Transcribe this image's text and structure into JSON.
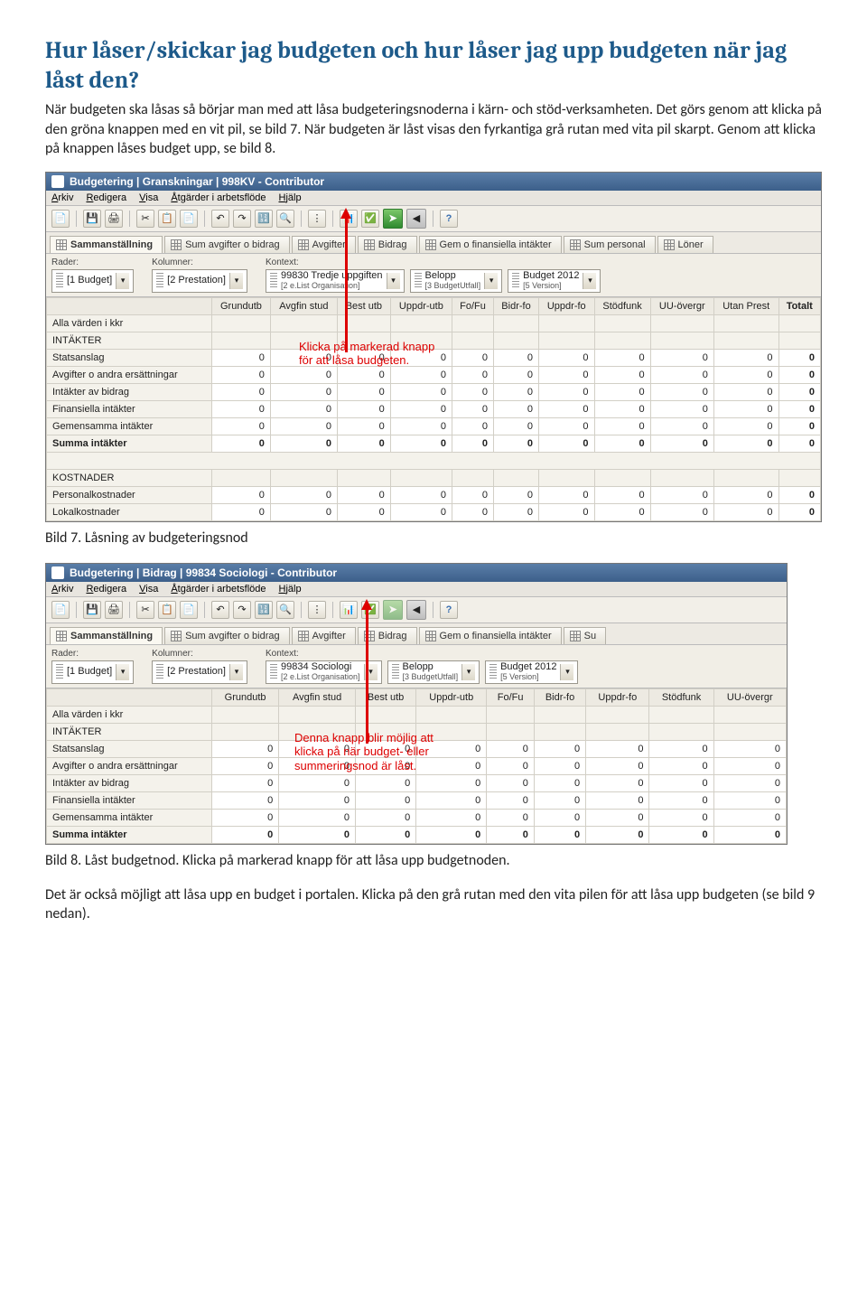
{
  "heading": "Hur låser/skickar jag budgeten och hur låser jag upp budgeten när jag låst den?",
  "intro": "När budgeten ska låsas så börjar man med att låsa budgeteringsnoderna i kärn- och stöd-verksamheten. Det görs genom att klicka på den gröna knappen med en vit pil, se bild 7. När budgeten är låst visas den fyrkantiga grå rutan med vita pil skarpt. Genom att klicka på knappen låses budget upp, se bild 8.",
  "caption7": "Bild 7. Låsning av budgeteringsnod",
  "caption8": "Bild 8. Låst budgetnod. Klicka på markerad knapp för att låsa upp budgetnoden.",
  "outro": "Det är också möjligt att låsa upp en budget i portalen. Klicka på den grå rutan med den vita pilen för att låsa upp budgeten (se bild 9 nedan).",
  "shot1": {
    "title": "Budgetering | Granskningar | 998KV - Contributor",
    "menus": [
      "Arkiv",
      "Redigera",
      "Visa",
      "Åtgärder i arbetsflöde",
      "Hjälp"
    ],
    "tabs": [
      "Sammanställning",
      "Sum avgifter o bidrag",
      "Avgifter",
      "Bidrag",
      "Gem o finansiella intäkter",
      "Sum personal",
      "Löner"
    ],
    "selectors": {
      "rader_lbl": "Rader:",
      "rader": "[1 Budget]",
      "kolumner_lbl": "Kolumner:",
      "kolumner": "[2 Prestation]",
      "kontext_lbl": "Kontext:",
      "kontext": "99830 Tredje uppgiften",
      "kontext_sub": "[2 e.List Organisation]",
      "belopp": "Belopp",
      "belopp_sub": "[3 BudgetUtfall]",
      "version": "Budget 2012",
      "version_sub": "[5 Version]"
    },
    "cols": [
      "Grundutb",
      "Avgfin stud",
      "Best utb",
      "Uppdr-utb",
      "Fo/Fu",
      "Bidr-fo",
      "Uppdr-fo",
      "Stödfunk",
      "UU-övergr",
      "Utan Prest",
      "Totalt"
    ],
    "rows": [
      {
        "label": "Alla värden i kkr",
        "type": "section"
      },
      {
        "label": "INTÄKTER",
        "type": "section"
      },
      {
        "label": "Statsanslag",
        "vals": [
          0,
          0,
          0,
          0,
          0,
          0,
          0,
          0,
          0,
          0,
          0
        ]
      },
      {
        "label": "Avgifter o andra ersättningar",
        "vals": [
          0,
          0,
          0,
          0,
          0,
          0,
          0,
          0,
          0,
          0,
          0
        ]
      },
      {
        "label": "Intäkter av bidrag",
        "vals": [
          0,
          0,
          0,
          0,
          0,
          0,
          0,
          0,
          0,
          0,
          0
        ]
      },
      {
        "label": "Finansiella intäkter",
        "vals": [
          0,
          0,
          0,
          0,
          0,
          0,
          0,
          0,
          0,
          0,
          0
        ]
      },
      {
        "label": "Gemensamma intäkter",
        "vals": [
          0,
          0,
          0,
          0,
          0,
          0,
          0,
          0,
          0,
          0,
          0
        ]
      },
      {
        "label": "Summa intäkter",
        "vals": [
          0,
          0,
          0,
          0,
          0,
          0,
          0,
          0,
          0,
          0,
          0
        ],
        "bold": true
      },
      {
        "label": "",
        "type": "spacer"
      },
      {
        "label": "KOSTNADER",
        "type": "section"
      },
      {
        "label": "Personalkostnader",
        "vals": [
          0,
          0,
          0,
          0,
          0,
          0,
          0,
          0,
          0,
          0,
          0
        ]
      },
      {
        "label": "Lokalkostnader",
        "vals": [
          0,
          0,
          0,
          0,
          0,
          0,
          0,
          0,
          0,
          0,
          0
        ]
      }
    ],
    "annotation": "Klicka på markerad knapp\nför att låsa budgeten."
  },
  "shot2": {
    "title": "Budgetering | Bidrag | 99834 Sociologi - Contributor",
    "menus": [
      "Arkiv",
      "Redigera",
      "Visa",
      "Åtgärder i arbetsflöde",
      "Hjälp"
    ],
    "tabs": [
      "Sammanställning",
      "Sum avgifter o bidrag",
      "Avgifter",
      "Bidrag",
      "Gem o finansiella intäkter",
      "Su"
    ],
    "selectors": {
      "rader_lbl": "Rader:",
      "rader": "[1 Budget]",
      "kolumner_lbl": "Kolumner:",
      "kolumner": "[2 Prestation]",
      "kontext_lbl": "Kontext:",
      "kontext": "99834 Sociologi",
      "kontext_sub": "[2 e.List Organisation]",
      "belopp": "Belopp",
      "belopp_sub": "[3 BudgetUtfall]",
      "version": "Budget 2012",
      "version_sub": "[5 Version]"
    },
    "cols": [
      "Grundutb",
      "Avgfin stud",
      "Best utb",
      "Uppdr-utb",
      "Fo/Fu",
      "Bidr-fo",
      "Uppdr-fo",
      "Stödfunk",
      "UU-övergr"
    ],
    "rows": [
      {
        "label": "Alla värden i kkr",
        "type": "section"
      },
      {
        "label": "INTÄKTER",
        "type": "section"
      },
      {
        "label": "Statsanslag",
        "vals": [
          0,
          0,
          0,
          0,
          0,
          0,
          0,
          0,
          0
        ]
      },
      {
        "label": "Avgifter o andra ersättningar",
        "vals": [
          0,
          0,
          0,
          0,
          0,
          0,
          0,
          0,
          0
        ]
      },
      {
        "label": "Intäkter av bidrag",
        "vals": [
          0,
          0,
          0,
          0,
          0,
          0,
          0,
          0,
          0
        ]
      },
      {
        "label": "Finansiella intäkter",
        "vals": [
          0,
          0,
          0,
          0,
          0,
          0,
          0,
          0,
          0
        ]
      },
      {
        "label": "Gemensamma intäkter",
        "vals": [
          0,
          0,
          0,
          0,
          0,
          0,
          0,
          0,
          0
        ]
      },
      {
        "label": "Summa intäkter",
        "vals": [
          0,
          0,
          0,
          0,
          0,
          0,
          0,
          0,
          0
        ],
        "bold": true
      }
    ],
    "annotation": "Denna knapp blir möjlig att\nklicka på när budget- eller\nsummeringsnod är låst."
  }
}
